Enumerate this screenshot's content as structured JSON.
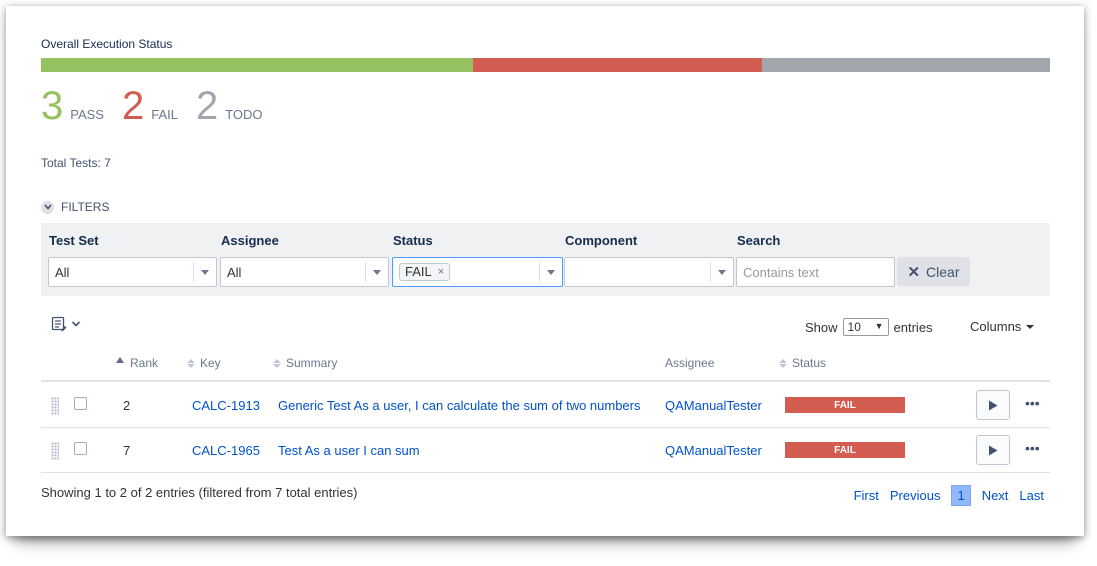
{
  "header": {
    "title": "Overall Execution Status"
  },
  "progress": [
    {
      "status": "PASS",
      "count": 3,
      "color": "#95c160"
    },
    {
      "status": "FAIL",
      "count": 2,
      "color": "#d45d52"
    },
    {
      "status": "TODO",
      "count": 2,
      "color": "#a1a6ad"
    }
  ],
  "stats": [
    {
      "num": "3",
      "label": "PASS",
      "color": "#95c160"
    },
    {
      "num": "2",
      "label": "FAIL",
      "color": "#d45d52"
    },
    {
      "num": "2",
      "label": "TODO",
      "color": "#a1a6ad"
    }
  ],
  "total_tests": "Total Tests: 7",
  "filters": {
    "toggle_label": "FILTERS",
    "test_set": {
      "label": "Test Set",
      "value": "All"
    },
    "assignee": {
      "label": "Assignee",
      "value": "All"
    },
    "status": {
      "label": "Status",
      "chip": "FAIL",
      "chip_remove": "×"
    },
    "component": {
      "label": "Component",
      "value": ""
    },
    "search": {
      "label": "Search",
      "placeholder": "Contains text"
    },
    "clear_label": "Clear"
  },
  "table_controls": {
    "show_label": "Show",
    "page_size": "10",
    "entries_label": "entries",
    "columns_label": "Columns"
  },
  "columns": {
    "rank": "Rank",
    "key": "Key",
    "summary": "Summary",
    "assignee": "Assignee",
    "status": "Status"
  },
  "rows": [
    {
      "rank": "2",
      "key": "CALC-1913",
      "summary": "Generic Test As a user, I can calculate the sum of two numbers",
      "assignee": "QAManualTester",
      "status": "FAIL"
    },
    {
      "rank": "7",
      "key": "CALC-1965",
      "summary": "Test As a user I can sum",
      "assignee": "QAManualTester",
      "status": "FAIL"
    }
  ],
  "footer": {
    "info": "Showing 1 to 2 of 2 entries (filtered from 7 total entries)",
    "first": "First",
    "previous": "Previous",
    "page": "1",
    "next": "Next",
    "last": "Last"
  }
}
